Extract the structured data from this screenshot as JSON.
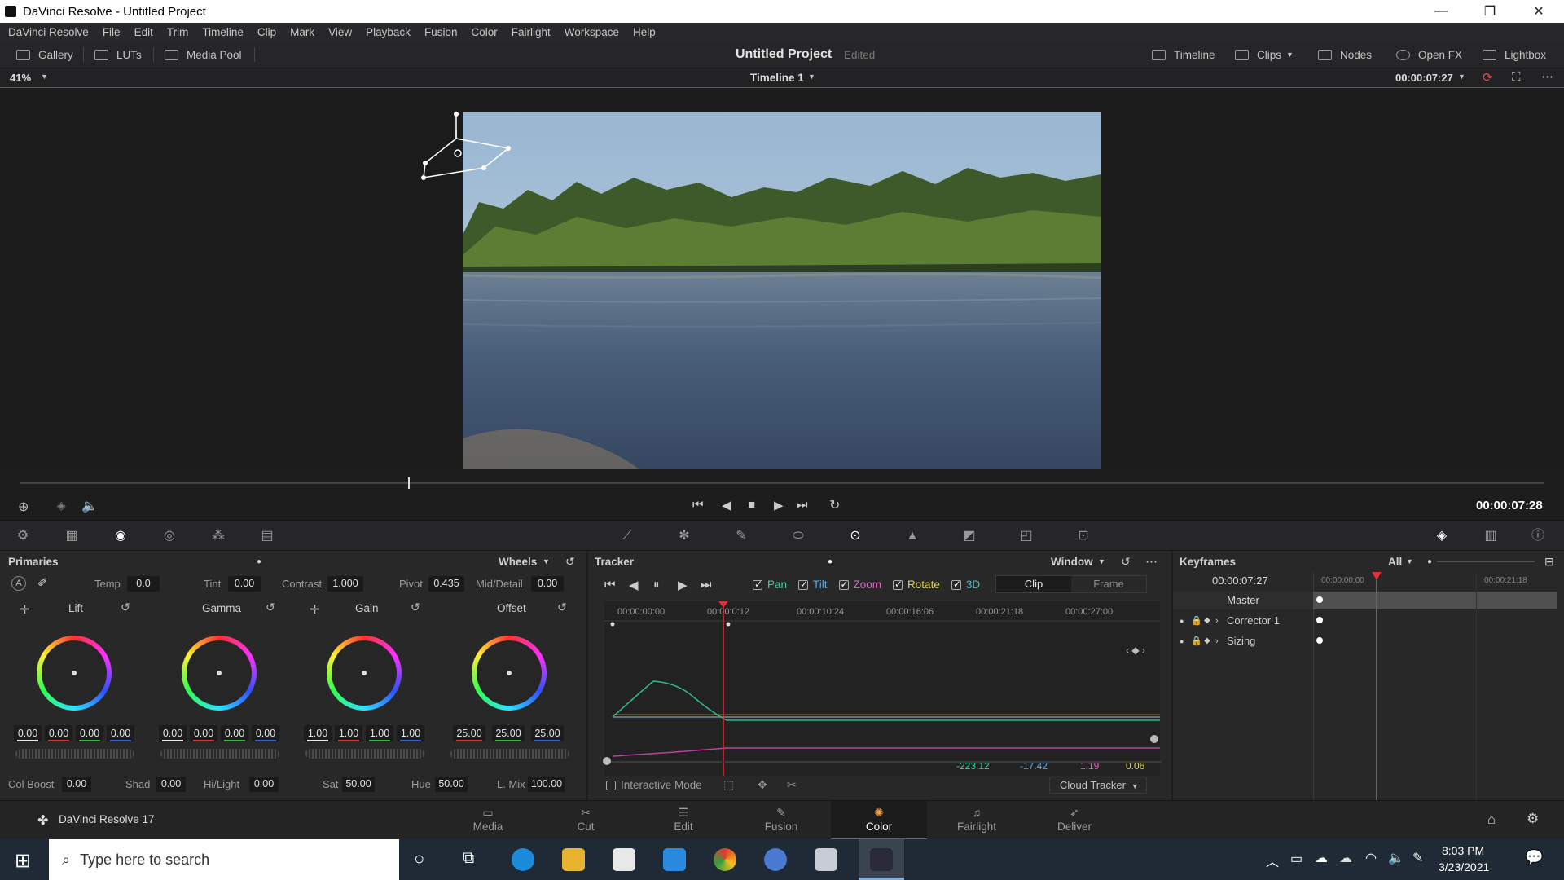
{
  "window": {
    "title": "DaVinci Resolve - Untitled Project",
    "minimize": "—",
    "restore": "❐",
    "close": "✕"
  },
  "menu": [
    "DaVinci Resolve",
    "File",
    "Edit",
    "Trim",
    "Timeline",
    "Clip",
    "Mark",
    "View",
    "Playback",
    "Fusion",
    "Color",
    "Fairlight",
    "Workspace",
    "Help"
  ],
  "toolbar": {
    "gallery": "Gallery",
    "luts": "LUTs",
    "media_pool": "Media Pool",
    "project_title": "Untitled Project",
    "project_status": "Edited",
    "timeline": "Timeline",
    "clips": "Clips",
    "nodes": "Nodes",
    "openfx": "Open FX",
    "lightbox": "Lightbox"
  },
  "viewer": {
    "zoom": "41%",
    "timeline_name": "Timeline 1",
    "timecode_top": "00:00:07:27",
    "timecode": "00:00:07:28",
    "scrub_fraction": 0.255
  },
  "primaries": {
    "title": "Primaries",
    "mode": "Wheels",
    "temp_label": "Temp",
    "temp": "0.0",
    "tint_label": "Tint",
    "tint": "0.00",
    "contrast_label": "Contrast",
    "contrast": "1.000",
    "pivot_label": "Pivot",
    "pivot": "0.435",
    "middetail_label": "Mid/Detail",
    "middetail": "0.00",
    "wheels": [
      {
        "name": "Lift",
        "values": [
          "0.00",
          "0.00",
          "0.00",
          "0.00"
        ]
      },
      {
        "name": "Gamma",
        "values": [
          "0.00",
          "0.00",
          "0.00",
          "0.00"
        ]
      },
      {
        "name": "Gain",
        "values": [
          "1.00",
          "1.00",
          "1.00",
          "1.00"
        ]
      },
      {
        "name": "Offset",
        "values": [
          "25.00",
          "25.00",
          "25.00"
        ]
      }
    ],
    "colboost_label": "Col Boost",
    "colboost": "0.00",
    "shad_label": "Shad",
    "shad": "0.00",
    "hilight_label": "Hi/Light",
    "hilight": "0.00",
    "sat_label": "Sat",
    "sat": "50.00",
    "hue_label": "Hue",
    "hue": "50.00",
    "lmix_label": "L. Mix",
    "lmix": "100.00"
  },
  "tracker": {
    "title": "Tracker",
    "mode": "Window",
    "options": [
      {
        "label": "Pan",
        "color": "#3fd0a8"
      },
      {
        "label": "Tilt",
        "color": "#4aa8ff"
      },
      {
        "label": "Zoom",
        "color": "#e060c0"
      },
      {
        "label": "Rotate",
        "color": "#e0d040"
      },
      {
        "label": "3D",
        "color": "#44c0c8"
      }
    ],
    "tab_clip": "Clip",
    "tab_frame": "Frame",
    "ruler": [
      "00:00:00:00",
      "00:00:0:12",
      "00:00:10:24",
      "00:00:16:06",
      "00:00:21:18",
      "00:00:27:00"
    ],
    "readouts": [
      {
        "value": "-223.12",
        "color": "#3fd0a8"
      },
      {
        "value": "-17.42",
        "color": "#4aa8ff"
      },
      {
        "value": "1.19",
        "color": "#e060c0"
      },
      {
        "value": "0.06",
        "color": "#e0d040"
      }
    ],
    "interactive_mode": "Interactive Mode",
    "cloud_tracker": "Cloud Tracker"
  },
  "keyframes": {
    "title": "Keyframes",
    "filter": "All",
    "timecode": "00:00:07:27",
    "ruler_start": "00:00:00:00",
    "ruler_end": "00:00:21:18",
    "rows": [
      "Master",
      "Corrector 1",
      "Sizing"
    ]
  },
  "pages": {
    "app": "DaVinci Resolve 17",
    "items": [
      "Media",
      "Cut",
      "Edit",
      "Fusion",
      "Color",
      "Fairlight",
      "Deliver"
    ],
    "active": "Color"
  },
  "taskbar": {
    "search": "Type here to search",
    "time": "8:03 PM",
    "date": "3/23/2021"
  },
  "colors": {
    "accent": "#e0303a",
    "panel": "#282829",
    "playhead": "#e0303a"
  }
}
